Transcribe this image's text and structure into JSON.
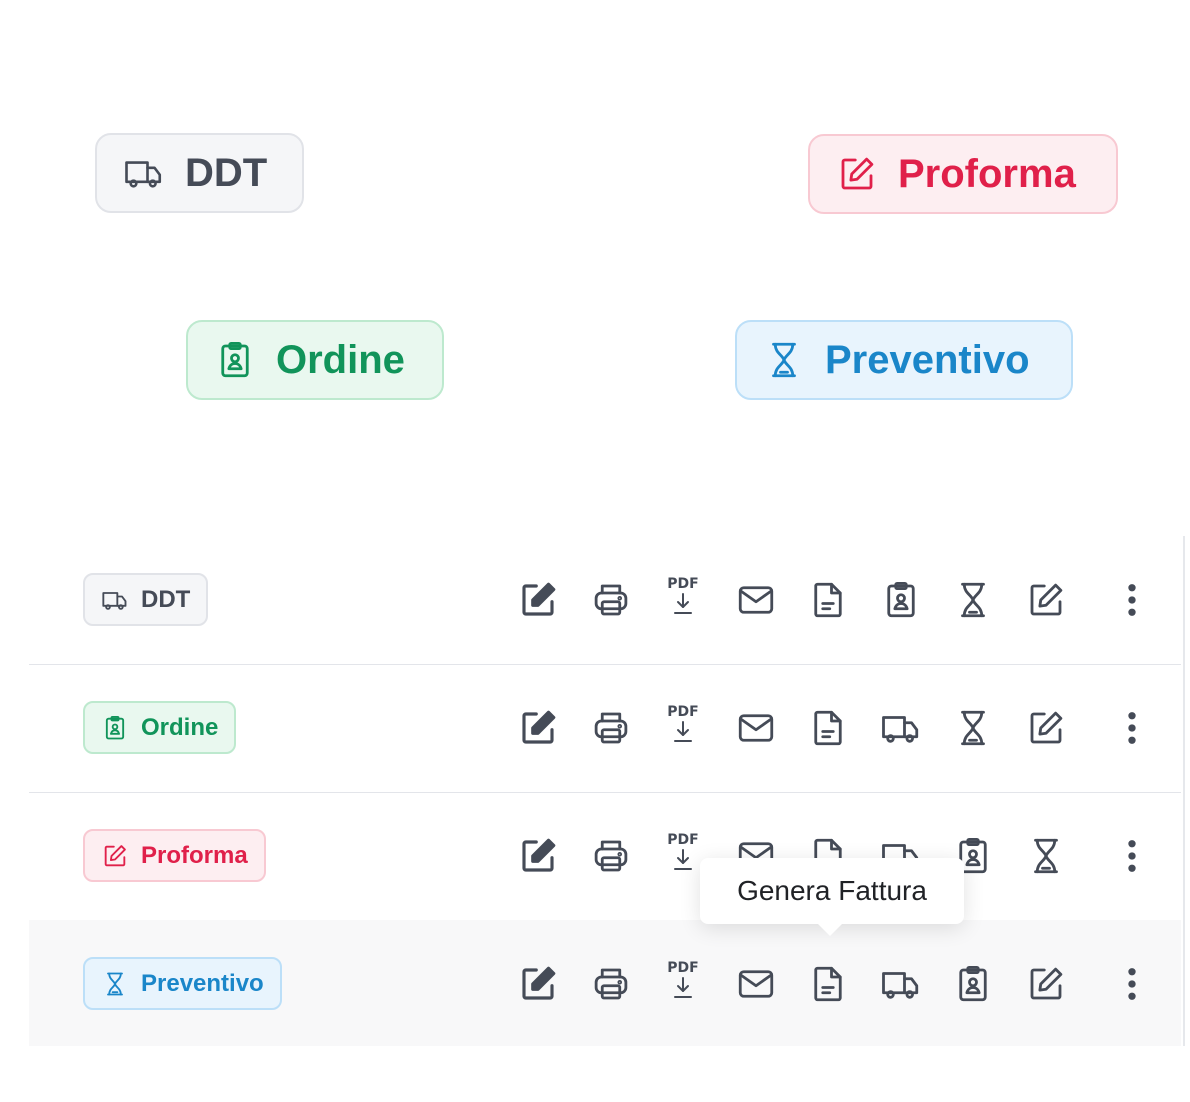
{
  "legend": {
    "ddt": "DDT",
    "proforma": "Proforma",
    "ordine": "Ordine",
    "preventivo": "Preventivo"
  },
  "rows": [
    {
      "badge": "DDT",
      "badge_icon": "truck-icon",
      "convert_icons": [
        "invoice-icon",
        "order-icon",
        "quote-icon",
        "proforma-icon"
      ]
    },
    {
      "badge": "Ordine",
      "badge_icon": "order-icon",
      "convert_icons": [
        "invoice-icon",
        "truck-icon",
        "quote-icon",
        "proforma-icon"
      ]
    },
    {
      "badge": "Proforma",
      "badge_icon": "proforma-icon",
      "convert_icons": [
        "invoice-icon",
        "truck-icon",
        "order-icon",
        "quote-icon"
      ]
    },
    {
      "badge": "Preventivo",
      "badge_icon": "quote-icon",
      "convert_icons": [
        "invoice-icon",
        "truck-icon",
        "order-icon",
        "proforma-icon"
      ]
    }
  ],
  "actions": {
    "pdf_label": "PDF",
    "common": [
      "edit-icon",
      "print-icon",
      "pdf-download-icon",
      "email-icon"
    ],
    "more": "more-vertical-icon"
  },
  "tooltip": {
    "text": "Genera Fattura"
  },
  "colors": {
    "ddt": "#454b57",
    "proforma": "#e0204a",
    "ordine": "#11945a",
    "preventivo": "#1a86c9",
    "icon": "#454b57"
  }
}
